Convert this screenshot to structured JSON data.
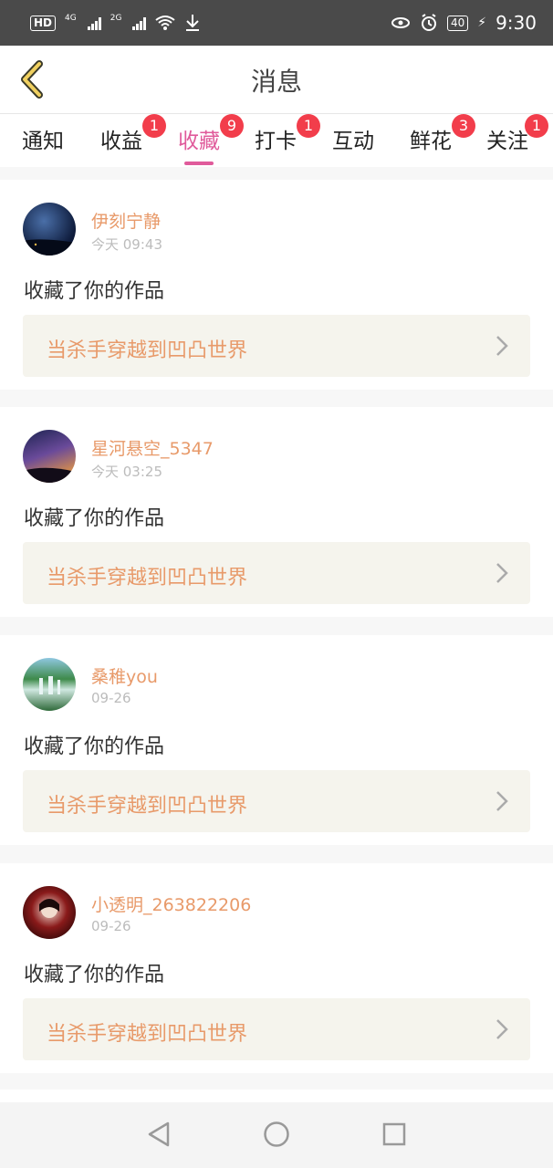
{
  "status_bar": {
    "hd": "HD",
    "net1": "4G",
    "net2": "2G",
    "battery": "40",
    "time": "9:30"
  },
  "header": {
    "title": "消息"
  },
  "tabs": [
    {
      "label": "通知",
      "badge": ""
    },
    {
      "label": "收益",
      "badge": "1"
    },
    {
      "label": "收藏",
      "badge": "9",
      "active": true
    },
    {
      "label": "打卡",
      "badge": "1"
    },
    {
      "label": "互动",
      "badge": ""
    },
    {
      "label": "鲜花",
      "badge": "3"
    },
    {
      "label": "关注",
      "badge": "1"
    }
  ],
  "messages": [
    {
      "user": "伊刻宁静",
      "time": "今天 09:43",
      "action": "收藏了你的作品",
      "work": "当杀手穿越到凹凸世界"
    },
    {
      "user": "星河悬空_5347",
      "time": "今天 03:25",
      "action": "收藏了你的作品",
      "work": "当杀手穿越到凹凸世界"
    },
    {
      "user": "桑稚you",
      "time": "09-26",
      "action": "收藏了你的作品",
      "work": "当杀手穿越到凹凸世界"
    },
    {
      "user": "小透明_263822206",
      "time": "09-26",
      "action": "收藏了你的作品",
      "work": "当杀手穿越到凹凸世界"
    }
  ],
  "colors": {
    "accent": "#e05b9b",
    "username": "#e89a6a",
    "badge": "#f23d4b"
  },
  "icons": {
    "back": "chevron-left-icon",
    "work_arrow": "chevron-right-icon",
    "nav": [
      "back-triangle-icon",
      "home-circle-icon",
      "recents-square-icon"
    ]
  }
}
